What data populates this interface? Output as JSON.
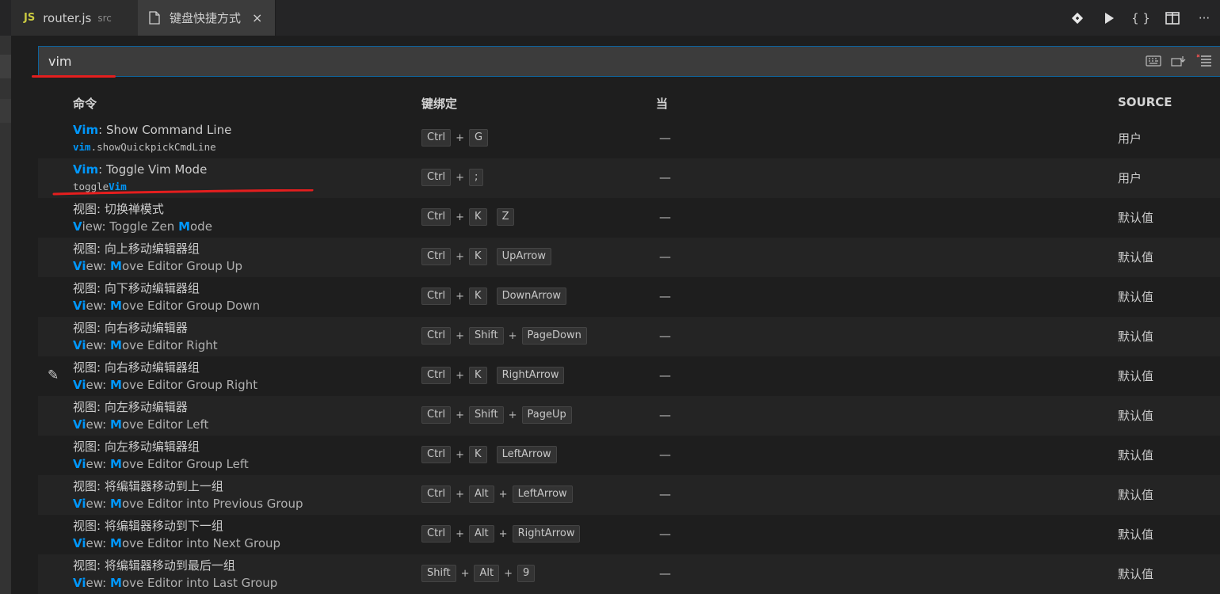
{
  "tabs": [
    {
      "icon_label": "JS",
      "name": "router.js",
      "dir": "src",
      "active": false
    },
    {
      "icon": "file-icon",
      "name": "键盘快捷方式",
      "close": "×",
      "active": true
    }
  ],
  "toolbar": {
    "icons": [
      "git-diff-icon",
      "run-icon",
      "braces-icon",
      "split-editor-icon",
      "more-icon"
    ],
    "braces_label": "{ }",
    "more_label": "···"
  },
  "search": {
    "value": "vim",
    "icons": [
      "keyboard-icon",
      "record-keys-icon",
      "sort-precedence-icon"
    ]
  },
  "table": {
    "headers": {
      "command": "命令",
      "keybinding": "键绑定",
      "when": "当",
      "source": "SOURCE"
    },
    "rows": [
      {
        "l1_hl": "Vim",
        "l1_rest": ": Show Command Line",
        "l2_hl": "vim",
        "l2_rest": ".showQuickpickCmdLine",
        "l2_mono": true,
        "keys": [
          "Ctrl",
          "+",
          "G"
        ],
        "when": "—",
        "source": "用户"
      },
      {
        "l1_hl": "Vim",
        "l1_rest": ": Toggle Vim Mode",
        "l2_pre": "toggle",
        "l2_hl": "Vim",
        "l2_mono": true,
        "keys": [
          "Ctrl",
          "+",
          ";"
        ],
        "when": "—",
        "source": "用户"
      },
      {
        "l1": "视图: 切换禅模式",
        "l2_a": "V",
        "l2_b": "iew: Toggle Zen ",
        "l2_c": "M",
        "l2_d": "ode",
        "keys": [
          "Ctrl",
          "+",
          "K",
          " ",
          "Z"
        ],
        "when": "—",
        "source": "默认值"
      },
      {
        "l1": "视图: 向上移动编辑器组",
        "l2_a": "Vi",
        "l2_b": "ew: ",
        "l2_c": "M",
        "l2_d": "ove Editor Group Up",
        "keys": [
          "Ctrl",
          "+",
          "K",
          " ",
          "UpArrow"
        ],
        "when": "—",
        "source": "默认值"
      },
      {
        "l1": "视图: 向下移动编辑器组",
        "l2_a": "Vi",
        "l2_b": "ew: ",
        "l2_c": "M",
        "l2_d": "ove Editor Group Down",
        "keys": [
          "Ctrl",
          "+",
          "K",
          " ",
          "DownArrow"
        ],
        "when": "—",
        "source": "默认值"
      },
      {
        "l1": "视图: 向右移动编辑器",
        "l2_a": "Vi",
        "l2_b": "ew: ",
        "l2_c": "M",
        "l2_d": "ove Editor Right",
        "keys": [
          "Ctrl",
          "+",
          "Shift",
          "+",
          "PageDown"
        ],
        "when": "—",
        "source": "默认值"
      },
      {
        "l1": "视图: 向右移动编辑器组",
        "l2_a": "Vi",
        "l2_b": "ew: ",
        "l2_c": "M",
        "l2_d": "ove Editor Group Right",
        "keys": [
          "Ctrl",
          "+",
          "K",
          " ",
          "RightArrow"
        ],
        "when": "—",
        "source": "默认值",
        "pencil": true
      },
      {
        "l1": "视图: 向左移动编辑器",
        "l2_a": "Vi",
        "l2_b": "ew: ",
        "l2_c": "M",
        "l2_d": "ove Editor Left",
        "keys": [
          "Ctrl",
          "+",
          "Shift",
          "+",
          "PageUp"
        ],
        "when": "—",
        "source": "默认值"
      },
      {
        "l1": "视图: 向左移动编辑器组",
        "l2_a": "Vi",
        "l2_b": "ew: ",
        "l2_c": "M",
        "l2_d": "ove Editor Group Left",
        "keys": [
          "Ctrl",
          "+",
          "K",
          " ",
          "LeftArrow"
        ],
        "when": "—",
        "source": "默认值"
      },
      {
        "l1": "视图: 将编辑器移动到上一组",
        "l2_a": "Vi",
        "l2_b": "ew: ",
        "l2_c": "M",
        "l2_d": "ove Editor into Previous Group",
        "keys": [
          "Ctrl",
          "+",
          "Alt",
          "+",
          "LeftArrow"
        ],
        "when": "—",
        "source": "默认值"
      },
      {
        "l1": "视图: 将编辑器移动到下一组",
        "l2_a": "Vi",
        "l2_b": "ew: ",
        "l2_c": "M",
        "l2_d": "ove Editor into Next Group",
        "keys": [
          "Ctrl",
          "+",
          "Alt",
          "+",
          "RightArrow"
        ],
        "when": "—",
        "source": "默认值"
      },
      {
        "l1": "视图: 将编辑器移动到最后一组",
        "l2_a": "Vi",
        "l2_b": "ew: ",
        "l2_c": "M",
        "l2_d": "ove Editor into Last Group",
        "keys": [
          "Shift",
          "+",
          "Alt",
          "+",
          "9"
        ],
        "when": "—",
        "source": "默认值"
      }
    ]
  }
}
